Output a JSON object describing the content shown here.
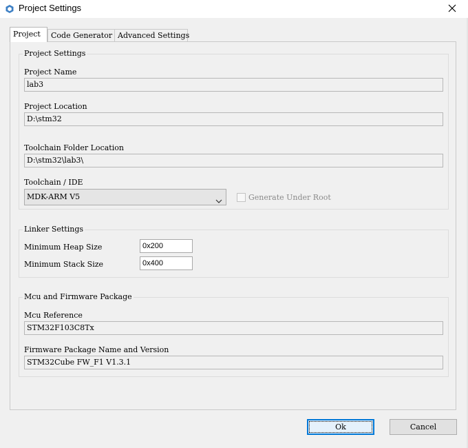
{
  "window": {
    "title": "Project Settings",
    "icon": "cube-icon",
    "close_icon": "close-icon"
  },
  "tabs": [
    {
      "label": "Project",
      "active": true
    },
    {
      "label": "Code Generator",
      "active": false
    },
    {
      "label": "Advanced Settings",
      "active": false
    }
  ],
  "project_settings": {
    "group_title": "Project Settings",
    "project_name_label": "Project Name",
    "project_name_value": "lab3",
    "project_location_label": "Project Location",
    "project_location_value": "D:\\stm32",
    "toolchain_folder_label": "Toolchain Folder Location",
    "toolchain_folder_value": "D:\\stm32\\lab3\\",
    "toolchain_ide_label": "Toolchain / IDE",
    "toolchain_ide_value": "MDK-ARM V5",
    "generate_under_root_label": "Generate Under Root",
    "generate_under_root_checked": false
  },
  "linker_settings": {
    "group_title": "Linker Settings",
    "min_heap_label": "Minimum Heap Size",
    "min_heap_value": "0x200",
    "min_stack_label": "Minimum Stack Size",
    "min_stack_value": "0x400"
  },
  "mcu_package": {
    "group_title": "Mcu and Firmware Package",
    "mcu_reference_label": "Mcu Reference",
    "mcu_reference_value": "STM32F103C8Tx",
    "firmware_label": "Firmware Package Name and Version",
    "firmware_value": "STM32Cube FW_F1 V1.3.1"
  },
  "buttons": {
    "ok_label": "Ok",
    "cancel_label": "Cancel"
  },
  "colors": {
    "default_button_border": "#0078d7",
    "dialog_background": "#f0f0f0"
  }
}
